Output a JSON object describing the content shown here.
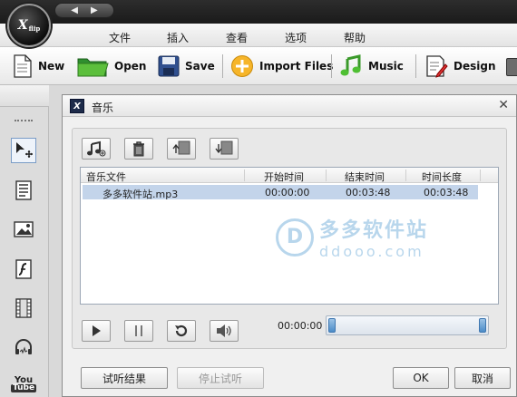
{
  "app": {
    "logo_text": "X",
    "logo_sub": "flip",
    "nav_back": "◀",
    "nav_forward": "▶"
  },
  "menu": [
    "文件",
    "插入",
    "查看",
    "选项",
    "帮助"
  ],
  "toolbar": {
    "new_label": "New",
    "open_label": "Open",
    "save_label": "Save",
    "import_label": "Import Files",
    "music_label": "Music",
    "design_label": "Design"
  },
  "left_tools": [
    "pointer-move-tool",
    "text-tool",
    "image-tool",
    "flash-tool",
    "video-tool",
    "audio-tool",
    "youtube-tool"
  ],
  "youtube_text": {
    "you": "You",
    "tube": "Tube"
  },
  "dialog": {
    "title": "音乐",
    "close": "✕",
    "list": {
      "columns": [
        "音乐文件",
        "开始时间",
        "结束时间",
        "时间长度"
      ],
      "rows": [
        {
          "file": "多多软件站.mp3",
          "start": "00:00:00",
          "end": "00:03:48",
          "length": "00:03:48"
        }
      ]
    },
    "time_display": "00:00:00",
    "buttons": {
      "preview_result": "试听结果",
      "stop_preview": "停止试听",
      "ok": "OK",
      "cancel": "取消"
    }
  },
  "watermark": {
    "logo": "D",
    "line1": "多多软件站",
    "line2": "ddooo.com"
  }
}
